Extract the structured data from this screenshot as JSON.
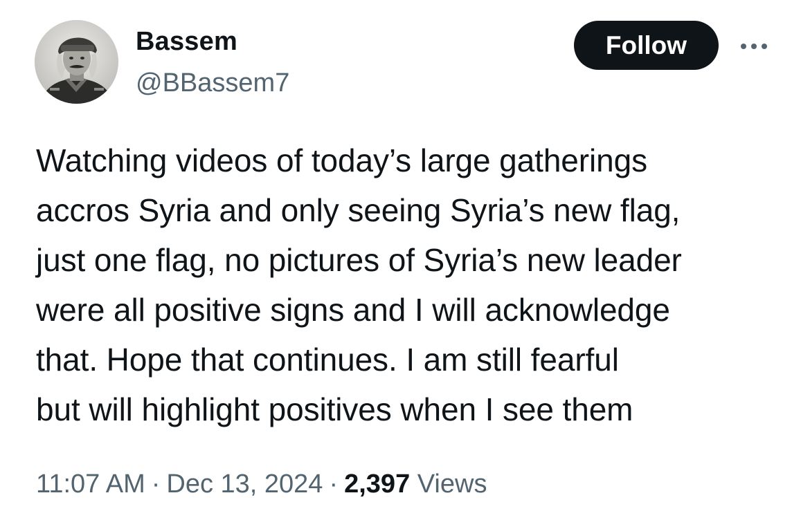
{
  "author": {
    "display_name": "Bassem",
    "handle": "@BBassem7",
    "avatar_icon": "vintage-portrait-avatar"
  },
  "actions": {
    "follow_label": "Follow",
    "more_icon": "more-horizontal-icon"
  },
  "tweet": {
    "text": "Watching videos of today’s large gatherings\naccros Syria and only seeing Syria’s new flag,\njust one flag, no pictures of Syria’s new leader\nwere all positive signs and I will acknowledge\nthat. Hope that continues. I am still fearful\nbut will highlight positives when I see them"
  },
  "meta": {
    "time": "11:07 AM",
    "separator": "·",
    "date": "Dec 13, 2024",
    "views_count": "2,397",
    "views_label": "Views"
  },
  "colors": {
    "text_primary": "#0f1419",
    "text_secondary": "#536471",
    "follow_bg": "#0f1419",
    "follow_text": "#ffffff",
    "background": "#ffffff"
  }
}
